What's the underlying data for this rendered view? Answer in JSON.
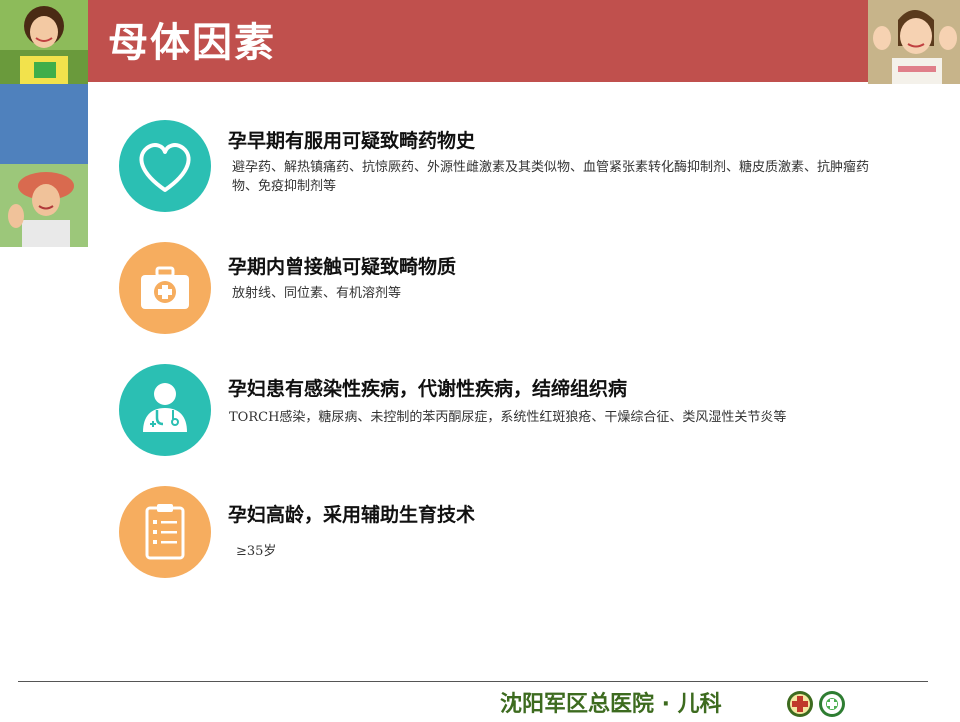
{
  "header": {
    "title": "母体因素"
  },
  "items": [
    {
      "icon": "heart-icon",
      "color": "#2bbfb3",
      "title": "孕早期有服用可疑致畸药物史",
      "desc": "避孕药、解热镇痛药、抗惊厥药、外源性雌激素及其类似物、血管紧张素转化酶抑制剂、糖皮质激素、抗肿瘤药物、免疫抑制剂等"
    },
    {
      "icon": "medical-kit-icon",
      "color": "#f6ad5f",
      "title": "孕期内曾接触可疑致畸物质",
      "desc": "放射线、同位素、有机溶剂等"
    },
    {
      "icon": "doctor-icon",
      "color": "#2bbfb3",
      "title": "孕妇患有感染性疾病，代谢性疾病，结缔组织病",
      "desc": "TORCH感染，糖尿病、未控制的苯丙酮尿症，系统性红斑狼疮、干燥综合征、类风湿性关节炎等"
    },
    {
      "icon": "clipboard-icon",
      "color": "#f6ad5f",
      "title": "孕妇高龄，采用辅助生育技术",
      "desc": "≥35岁"
    }
  ],
  "footer": {
    "hospital": "沈阳军区总医院 · 儿科"
  }
}
